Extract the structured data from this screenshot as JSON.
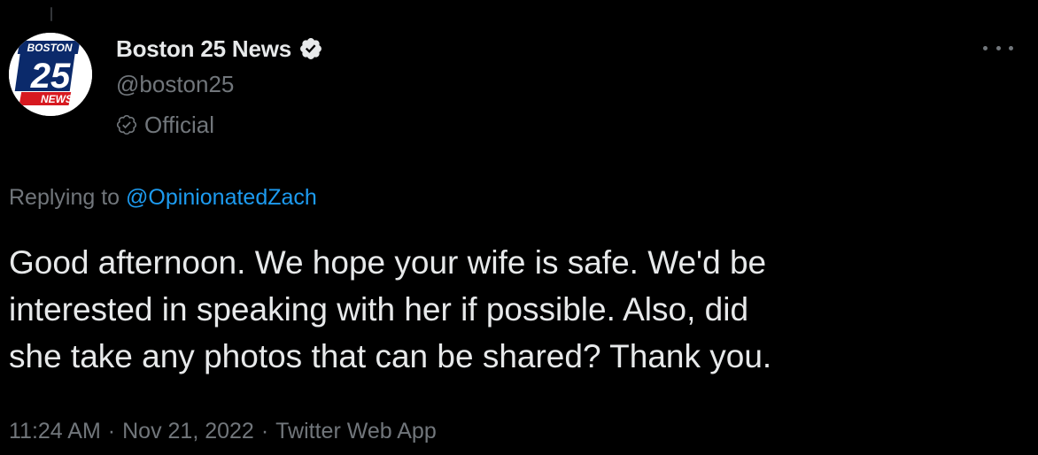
{
  "author": {
    "display_name": "Boston 25 News",
    "handle": "@boston25",
    "label": "Official",
    "avatar": {
      "top_text": "BOSTON",
      "number": "25",
      "bottom_text": "NEWS",
      "colors": {
        "navy": "#0b2a6b",
        "red": "#d71920",
        "white": "#ffffff"
      }
    }
  },
  "reply_context": {
    "prefix": "Replying to",
    "mention": "@OpinionatedZach"
  },
  "tweet": {
    "lines": [
      "Good afternoon. We hope your wife is safe. We'd be",
      "interested in speaking with her if possible. Also, did",
      "she take any photos that can be shared? Thank you."
    ]
  },
  "meta": {
    "time": "11:24 AM",
    "separator": "·",
    "date": "Nov 21, 2022",
    "source": "Twitter Web App"
  },
  "icons": {
    "verified": "verified-badge-icon",
    "official": "official-label-icon",
    "more": "more-options-icon"
  },
  "colors": {
    "background": "#000000",
    "primary_text": "#e7e9ea",
    "secondary_text": "#71767b",
    "link": "#1d9bf0"
  }
}
